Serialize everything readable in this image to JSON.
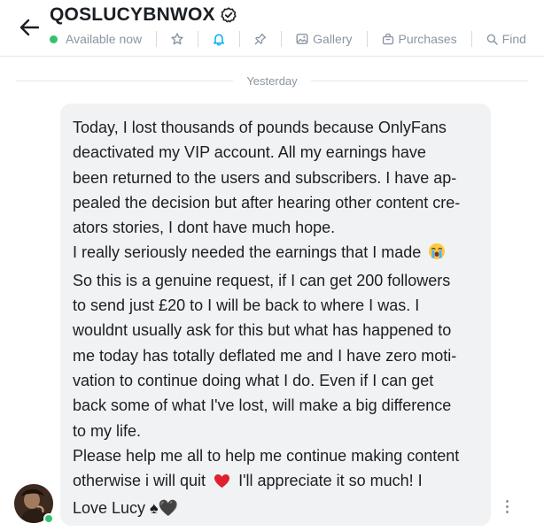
{
  "header": {
    "title": "QOSLUCYBNWOX",
    "status_text": "Available now",
    "tools": {
      "gallery_label": "Gallery",
      "purchases_label": "Purchases",
      "find_label": "Find"
    }
  },
  "divider": {
    "date_label": "Yesterday"
  },
  "message": {
    "lines": [
      "Today, I lost thousands of pounds because OnlyFans",
      "deactivated my VIP account. All my earnings have",
      "been returned to the users and subscribers. I have ap-",
      "pealed the decision but after hearing other content cre-",
      "ators stories, I dont have much hope.",
      "I really seriously needed the earnings that I made",
      "So this is a genuine request, if I can get 200 followers",
      "to send just £20 to I will be back to where I was. I",
      "wouldnt usually ask for this but what has happened to",
      "me today has totally deflated me and I have zero moti-",
      "vation to continue doing what I do. Even if I can get",
      "back some of what I've lost, will make a big difference",
      "to my life.",
      "Please help me all to help me continue making content",
      "otherwise i will quit",
      "I'll appreciate it so much! I",
      "Love Lucy ♠🖤"
    ]
  },
  "colors": {
    "accent": "#00aff0",
    "online": "#33c26b",
    "muted": "#8a96a3",
    "bubble": "#f1f2f3"
  },
  "icons": [
    "back-arrow-icon",
    "verified-icon",
    "star-icon",
    "bell-icon",
    "pin-icon",
    "gallery-icon",
    "purchases-icon",
    "search-icon",
    "crying-face-emoji",
    "heart-emoji",
    "more-icon"
  ]
}
